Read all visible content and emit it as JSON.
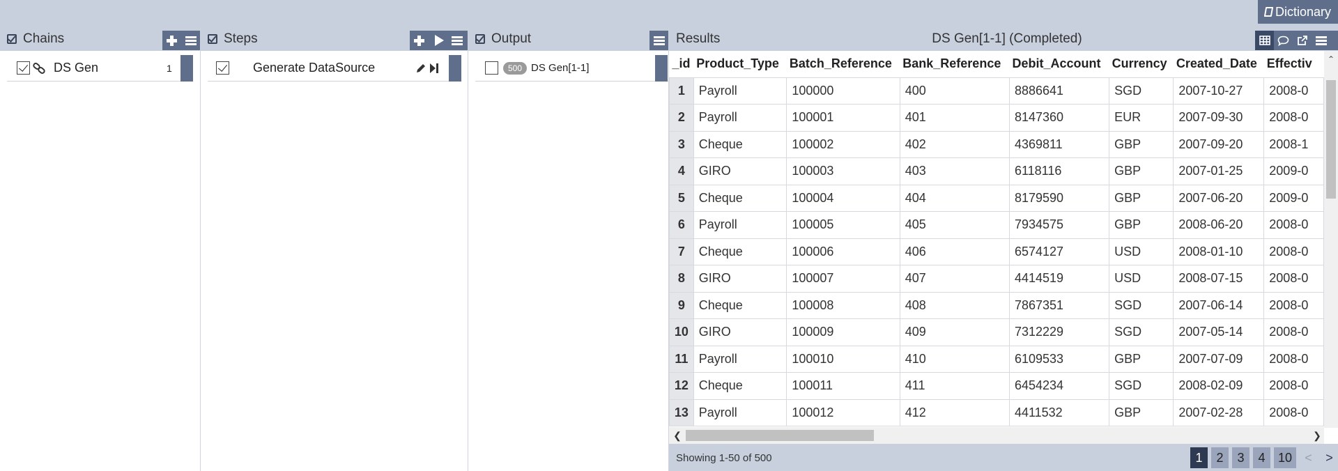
{
  "app": {
    "dictionary_label": "Dictionary"
  },
  "chains": {
    "title": "Chains",
    "items": [
      {
        "label": "DS Gen",
        "count": "1"
      }
    ]
  },
  "steps": {
    "title": "Steps",
    "items": [
      {
        "label": "Generate DataSource"
      }
    ]
  },
  "output": {
    "title": "Output",
    "items": [
      {
        "badge": "500",
        "label": "DS Gen[1-1]"
      }
    ]
  },
  "results": {
    "title": "Results",
    "subtitle": "DS Gen[1-1] (Completed)",
    "columns": [
      "_id",
      "Product_Type",
      "Batch_Reference",
      "Bank_Reference",
      "Debit_Account",
      "Currency",
      "Created_Date",
      "Effectiv"
    ],
    "rows": [
      [
        "1",
        "Payroll",
        "100000",
        "400",
        "8886641",
        "SGD",
        "2007-10-27",
        "2008-0"
      ],
      [
        "2",
        "Payroll",
        "100001",
        "401",
        "8147360",
        "EUR",
        "2007-09-30",
        "2008-0"
      ],
      [
        "3",
        "Cheque",
        "100002",
        "402",
        "4369811",
        "GBP",
        "2007-09-20",
        "2008-1"
      ],
      [
        "4",
        "GIRO",
        "100003",
        "403",
        "6118116",
        "GBP",
        "2007-01-25",
        "2009-0"
      ],
      [
        "5",
        "Cheque",
        "100004",
        "404",
        "8179590",
        "GBP",
        "2007-06-20",
        "2009-0"
      ],
      [
        "6",
        "Payroll",
        "100005",
        "405",
        "7934575",
        "GBP",
        "2008-06-20",
        "2008-0"
      ],
      [
        "7",
        "Cheque",
        "100006",
        "406",
        "6574127",
        "USD",
        "2008-01-10",
        "2008-0"
      ],
      [
        "8",
        "GIRO",
        "100007",
        "407",
        "4414519",
        "USD",
        "2008-07-15",
        "2008-0"
      ],
      [
        "9",
        "Cheque",
        "100008",
        "408",
        "7867351",
        "SGD",
        "2007-06-14",
        "2008-0"
      ],
      [
        "10",
        "GIRO",
        "100009",
        "409",
        "7312229",
        "SGD",
        "2007-05-14",
        "2008-0"
      ],
      [
        "11",
        "Payroll",
        "100010",
        "410",
        "6109533",
        "GBP",
        "2007-07-09",
        "2008-0"
      ],
      [
        "12",
        "Cheque",
        "100011",
        "411",
        "6454234",
        "SGD",
        "2008-02-09",
        "2008-0"
      ],
      [
        "13",
        "Payroll",
        "100012",
        "412",
        "4411532",
        "GBP",
        "2007-02-28",
        "2008-0"
      ]
    ],
    "status": "Showing 1-50 of 500",
    "pages": [
      "1",
      "2",
      "3",
      "4",
      "10"
    ],
    "prev_label": "<",
    "next_label": ">"
  }
}
